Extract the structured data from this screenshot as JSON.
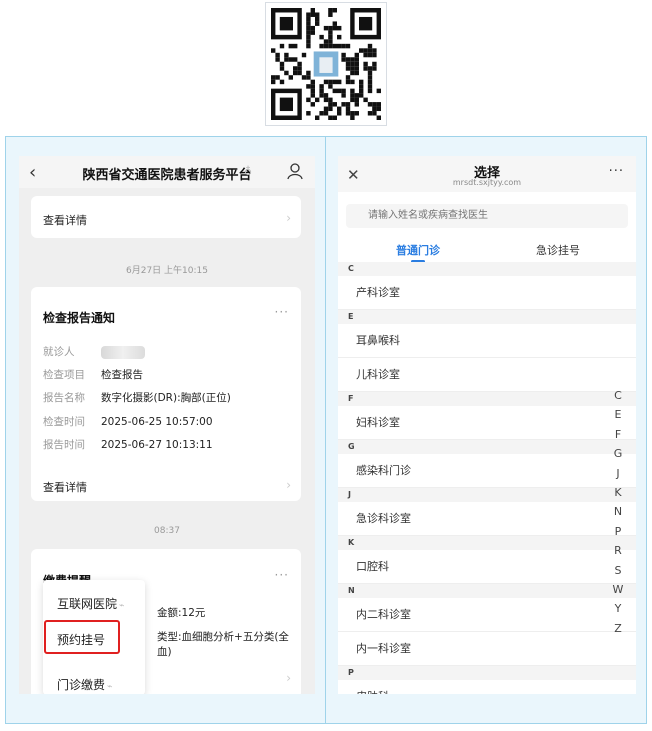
{
  "left_phone": {
    "title": "陕西省交通医院患者服务平台",
    "top_card": {
      "detail": "查看详情"
    },
    "timestamp1": "6月27日 上午10:15",
    "report_card": {
      "title": "检查报告通知",
      "fields": [
        {
          "key": "就诊人",
          "value": ""
        },
        {
          "key": "检查项目",
          "value": "检查报告"
        },
        {
          "key": "报告名称",
          "value": "数字化摄影(DR):胸部(正位)"
        },
        {
          "key": "检查时间",
          "value": "2025-06-25 10:57:00"
        },
        {
          "key": "报告时间",
          "value": "2025-06-27 10:13:11"
        }
      ],
      "detail": "查看详情"
    },
    "timestamp2": "08:37",
    "payment_card": {
      "title": "缴费提醒",
      "amount_fragment": "金额:12元",
      "type_fragment": "类型:血细胞分析+五分类(全血)"
    },
    "popup_menu": {
      "items": [
        "互联网医院",
        "预约挂号",
        "门诊缴费"
      ],
      "highlighted": "预约挂号"
    }
  },
  "right_phone": {
    "title": "选择",
    "url": "mrsdt.sxjtyy.com",
    "search_placeholder": "请输入姓名或疾病查找医生",
    "tabs": [
      "普通门诊",
      "急诊挂号"
    ],
    "active_tab": "普通门诊",
    "sections": [
      {
        "letter": "C",
        "items": [
          "产科诊室"
        ]
      },
      {
        "letter": "E",
        "items": [
          "耳鼻喉科",
          "儿科诊室"
        ]
      },
      {
        "letter": "F",
        "items": [
          "妇科诊室"
        ]
      },
      {
        "letter": "G",
        "items": [
          "感染科门诊"
        ]
      },
      {
        "letter": "J",
        "items": [
          "急诊科诊室"
        ]
      },
      {
        "letter": "K",
        "items": [
          "口腔科"
        ]
      },
      {
        "letter": "N",
        "items": [
          "内二科诊室",
          "内一科诊室"
        ]
      },
      {
        "letter": "P",
        "items": [
          "皮肤科"
        ]
      }
    ],
    "index_letters": [
      "C",
      "E",
      "F",
      "G",
      "J",
      "K",
      "N",
      "P",
      "R",
      "S",
      "W",
      "Y",
      "Z"
    ],
    "accent_color": "#2a7de1"
  },
  "highlight_color": "#e02020"
}
